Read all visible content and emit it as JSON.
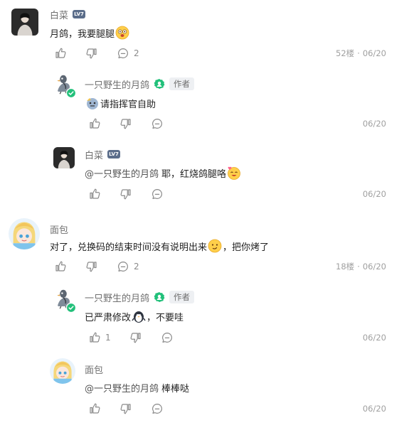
{
  "comments": [
    {
      "name": "白菜",
      "level_badge": "LV7",
      "text": "月鸽，我要腿腿",
      "comment_count": "2",
      "floor": "52楼",
      "date": "06/20",
      "replies": [
        {
          "name": "一只野生的月鸽",
          "author_tag": "作者",
          "text": "请指挥官自助",
          "date": "06/20"
        },
        {
          "name": "白菜",
          "level_badge": "LV7",
          "mention": "@一只野生的月鸽",
          "text": "耶，红烧鸽腿咯",
          "date": "06/20"
        }
      ]
    },
    {
      "name": "面包",
      "text_part1": "对了，兑换码的结束时间没有说明出来",
      "text_part2": "，把你烤了",
      "comment_count": "2",
      "floor": "18楼",
      "date": "06/20",
      "replies": [
        {
          "name": "一只野生的月鸽",
          "author_tag": "作者",
          "text_part1": "已严肃修改",
          "text_part2": "，不要哇",
          "like_count": "1",
          "date": "06/20"
        },
        {
          "name": "面包",
          "mention": "@一只野生的月鸽",
          "text": "棒棒哒",
          "date": "06/20"
        }
      ]
    }
  ],
  "meta_separator": "·",
  "icons": [
    "thumb-up-icon",
    "thumb-down-icon",
    "comment-icon"
  ],
  "colors": {
    "official_green": "#22c07a",
    "meta_gray": "#a0a0a0",
    "name_gray": "#707070"
  }
}
